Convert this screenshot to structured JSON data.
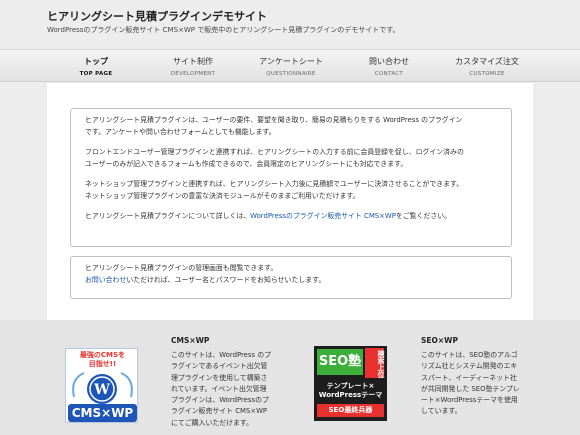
{
  "header": {
    "title": "ヒアリングシート見積プラグインデモサイト",
    "tagline": "WordPressのプラグイン販売サイト CMS×WP で販売中のヒアリングシート見積プラグインのデモサイトです。"
  },
  "nav": {
    "items": [
      {
        "label": "トップ",
        "sub": "TOP PAGE"
      },
      {
        "label": "サイト制作",
        "sub": "DEVELOPMENT"
      },
      {
        "label": "アンケートシート",
        "sub": "QUESTIONNAIRE"
      },
      {
        "label": "問い合わせ",
        "sub": "CONTACT"
      },
      {
        "label": "カスタマイズ注文",
        "sub": "CUSTOMIZE"
      }
    ]
  },
  "main": {
    "intro_lines": [
      "ヒアリングシート見積プラグインは、ユーザーの要件、要望を聞き取り、簡易の見積もりをする WordPress のプラグイン",
      "です。アンケートや問い合わせフォームとしても機能します。"
    ],
    "frontend_lines": [
      "フロントエンドユーザー管理プラグインと連携すれば、ヒアリングシートの入力する前に会員登録を促し、ログイン済みの",
      "ユーザーのみが記入できるフォームも作成できるので、会員限定のヒアリングシートにも対応できます。"
    ],
    "netshop_lines": [
      "ネットショップ管理プラグインと連携すれば、ヒアリングシート入力後に見積額でユーザーに決済させることができます。",
      "ネットショップ管理プラグインの豊富な決済モジュールがそのままご利用いただけます。"
    ],
    "details_before": "ヒアリングシート見積プラグインについて詳しくは、",
    "details_link": "WordPressのプラグイン販売サイト CMS×WP",
    "details_after": "をご覧ください。",
    "admin_line": "ヒアリングシート見積プラグインの管理画面も閲覧できます。",
    "admin_link": "お問い合わせ",
    "admin_after": "いただければ、ユーザー名とパスワードをお知らせいたします。"
  },
  "footer": {
    "cms_banner": {
      "tagline_line1": "最強のCMSを",
      "tagline_line2": "目指せ!!",
      "logo_text": "CMS×WP"
    },
    "cms_title": "CMS×WP",
    "cms_lines": [
      "このサイトは、WordPress のプ",
      "ラグインであるイベント出欠管",
      "理プラグインを使用して構築さ",
      "れています。イベント出欠管理",
      "プラグインは、WordPressのプ",
      "ラグイン販売サイト CMS×WP",
      "にてご購入いただけます。"
    ],
    "seo_banner": {
      "logo": "SEO塾",
      "badge": "検索上位",
      "line1": "テンプレート×",
      "line2": "WordPressテーマ",
      "bottom": "SEO最終兵器"
    },
    "seo_title": "SEO×WP",
    "seo_lines": [
      "このサイトは、SEO塾のアルゴ",
      "リズム社とシステム開発のエキ",
      "スパート、イーディーネット社",
      "が共同開発した SEO塾テンプレ",
      "ート×WordPressテーマを使用",
      "しています。"
    ]
  },
  "colors": {
    "link": "#1a56b0",
    "cms_banner_accent": "#e8312f",
    "cms_banner_blue": "#1e56b8",
    "seo_banner_green": "#3cae3a"
  }
}
